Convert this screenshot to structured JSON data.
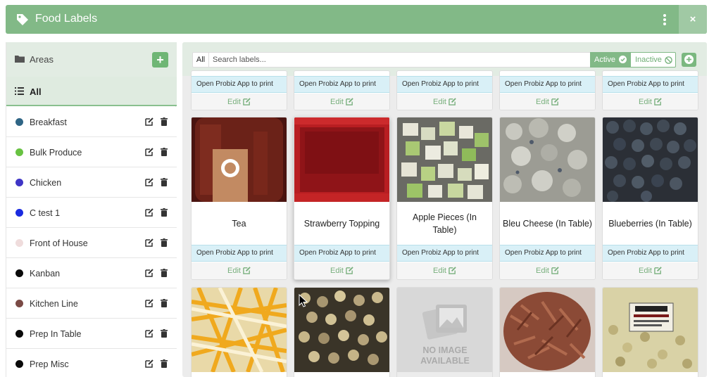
{
  "header": {
    "title": "Food Labels",
    "close_label": "×"
  },
  "sidebar": {
    "areas_label": "Areas",
    "add_label": "+",
    "all_label": "All",
    "items": [
      {
        "label": "Breakfast",
        "color": "#2f6585"
      },
      {
        "label": "Bulk Produce",
        "color": "#68c242"
      },
      {
        "label": "Chicken",
        "color": "#3f35c6"
      },
      {
        "label": "C test 1",
        "color": "#1a2be0"
      },
      {
        "label": "Front of House",
        "color": "#efdcdc"
      },
      {
        "label": "Kanban",
        "color": "#0a0a0a"
      },
      {
        "label": "Kitchen Line",
        "color": "#7a4a45"
      },
      {
        "label": "Prep In Table",
        "color": "#0a0a0a"
      },
      {
        "label": "Prep Misc",
        "color": "#0a0a0a"
      }
    ]
  },
  "toolbar": {
    "all_chip": "All",
    "search_placeholder": "Search labels...",
    "active_label": "Active",
    "inactive_label": "Inactive"
  },
  "cards": {
    "print_label": "Open Probiz App to print",
    "edit_label": "Edit",
    "row2": [
      {
        "name": "Tea"
      },
      {
        "name": "Strawberry Topping"
      },
      {
        "name": "Apple Pieces (In Table)"
      },
      {
        "name": "Bleu Cheese (In Table)"
      },
      {
        "name": "Blueberries (In Table)"
      }
    ],
    "no_image_text": "NO IMAGE AVAILABLE"
  }
}
